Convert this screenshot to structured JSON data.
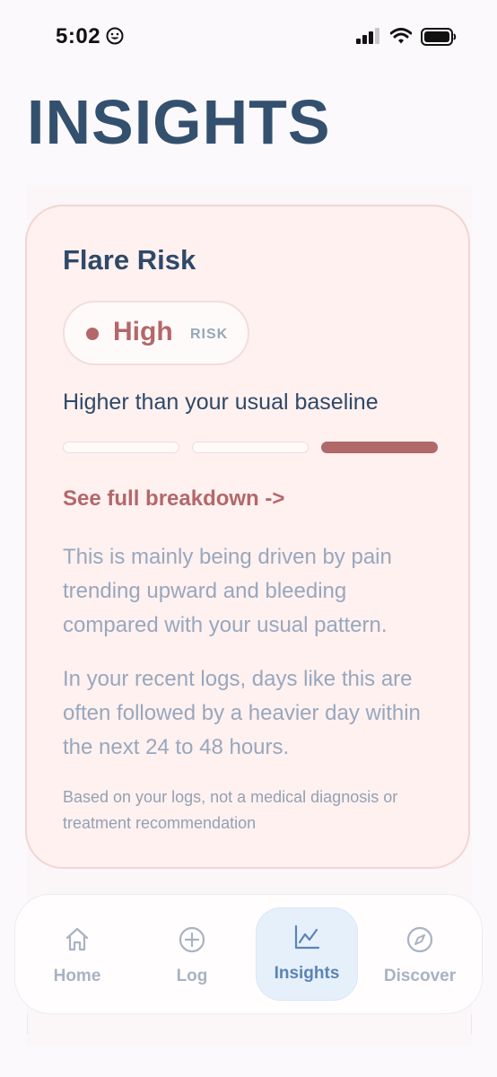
{
  "status_bar": {
    "time": "5:02"
  },
  "page": {
    "title": "INSIGHTS"
  },
  "flare_card": {
    "heading": "Flare Risk",
    "risk_level": "High",
    "risk_suffix": "RISK",
    "baseline_comparison": "Higher than your usual baseline",
    "risk_scale": {
      "segments": 3,
      "filled_segment": 3
    },
    "breakdown_link": "See full breakdown ->",
    "drivers_text": "This is mainly being driven by pain trending upward and bleeding compared with your usual pattern.",
    "forecast_text": "In your recent logs, days like this are often followed by a heavier day within the next 24 to 48 hours.",
    "disclaimer": "Based on your logs, not a medical diagnosis or treatment recommendation"
  },
  "tab_bar": {
    "active_tab": "Insights",
    "items": [
      {
        "label": "Home",
        "icon": "home-icon"
      },
      {
        "label": "Log",
        "icon": "plus-circle-icon"
      },
      {
        "label": "Insights",
        "icon": "chart-icon"
      },
      {
        "label": "Discover",
        "icon": "compass-icon"
      }
    ]
  },
  "colors": {
    "title": "#34506f",
    "accent_rose": "#b3686a",
    "card_background": "#fff1f0",
    "muted_text": "#98a7bd",
    "active_tab": "#5b84b5",
    "active_tab_bg": "#e6f0fb"
  }
}
